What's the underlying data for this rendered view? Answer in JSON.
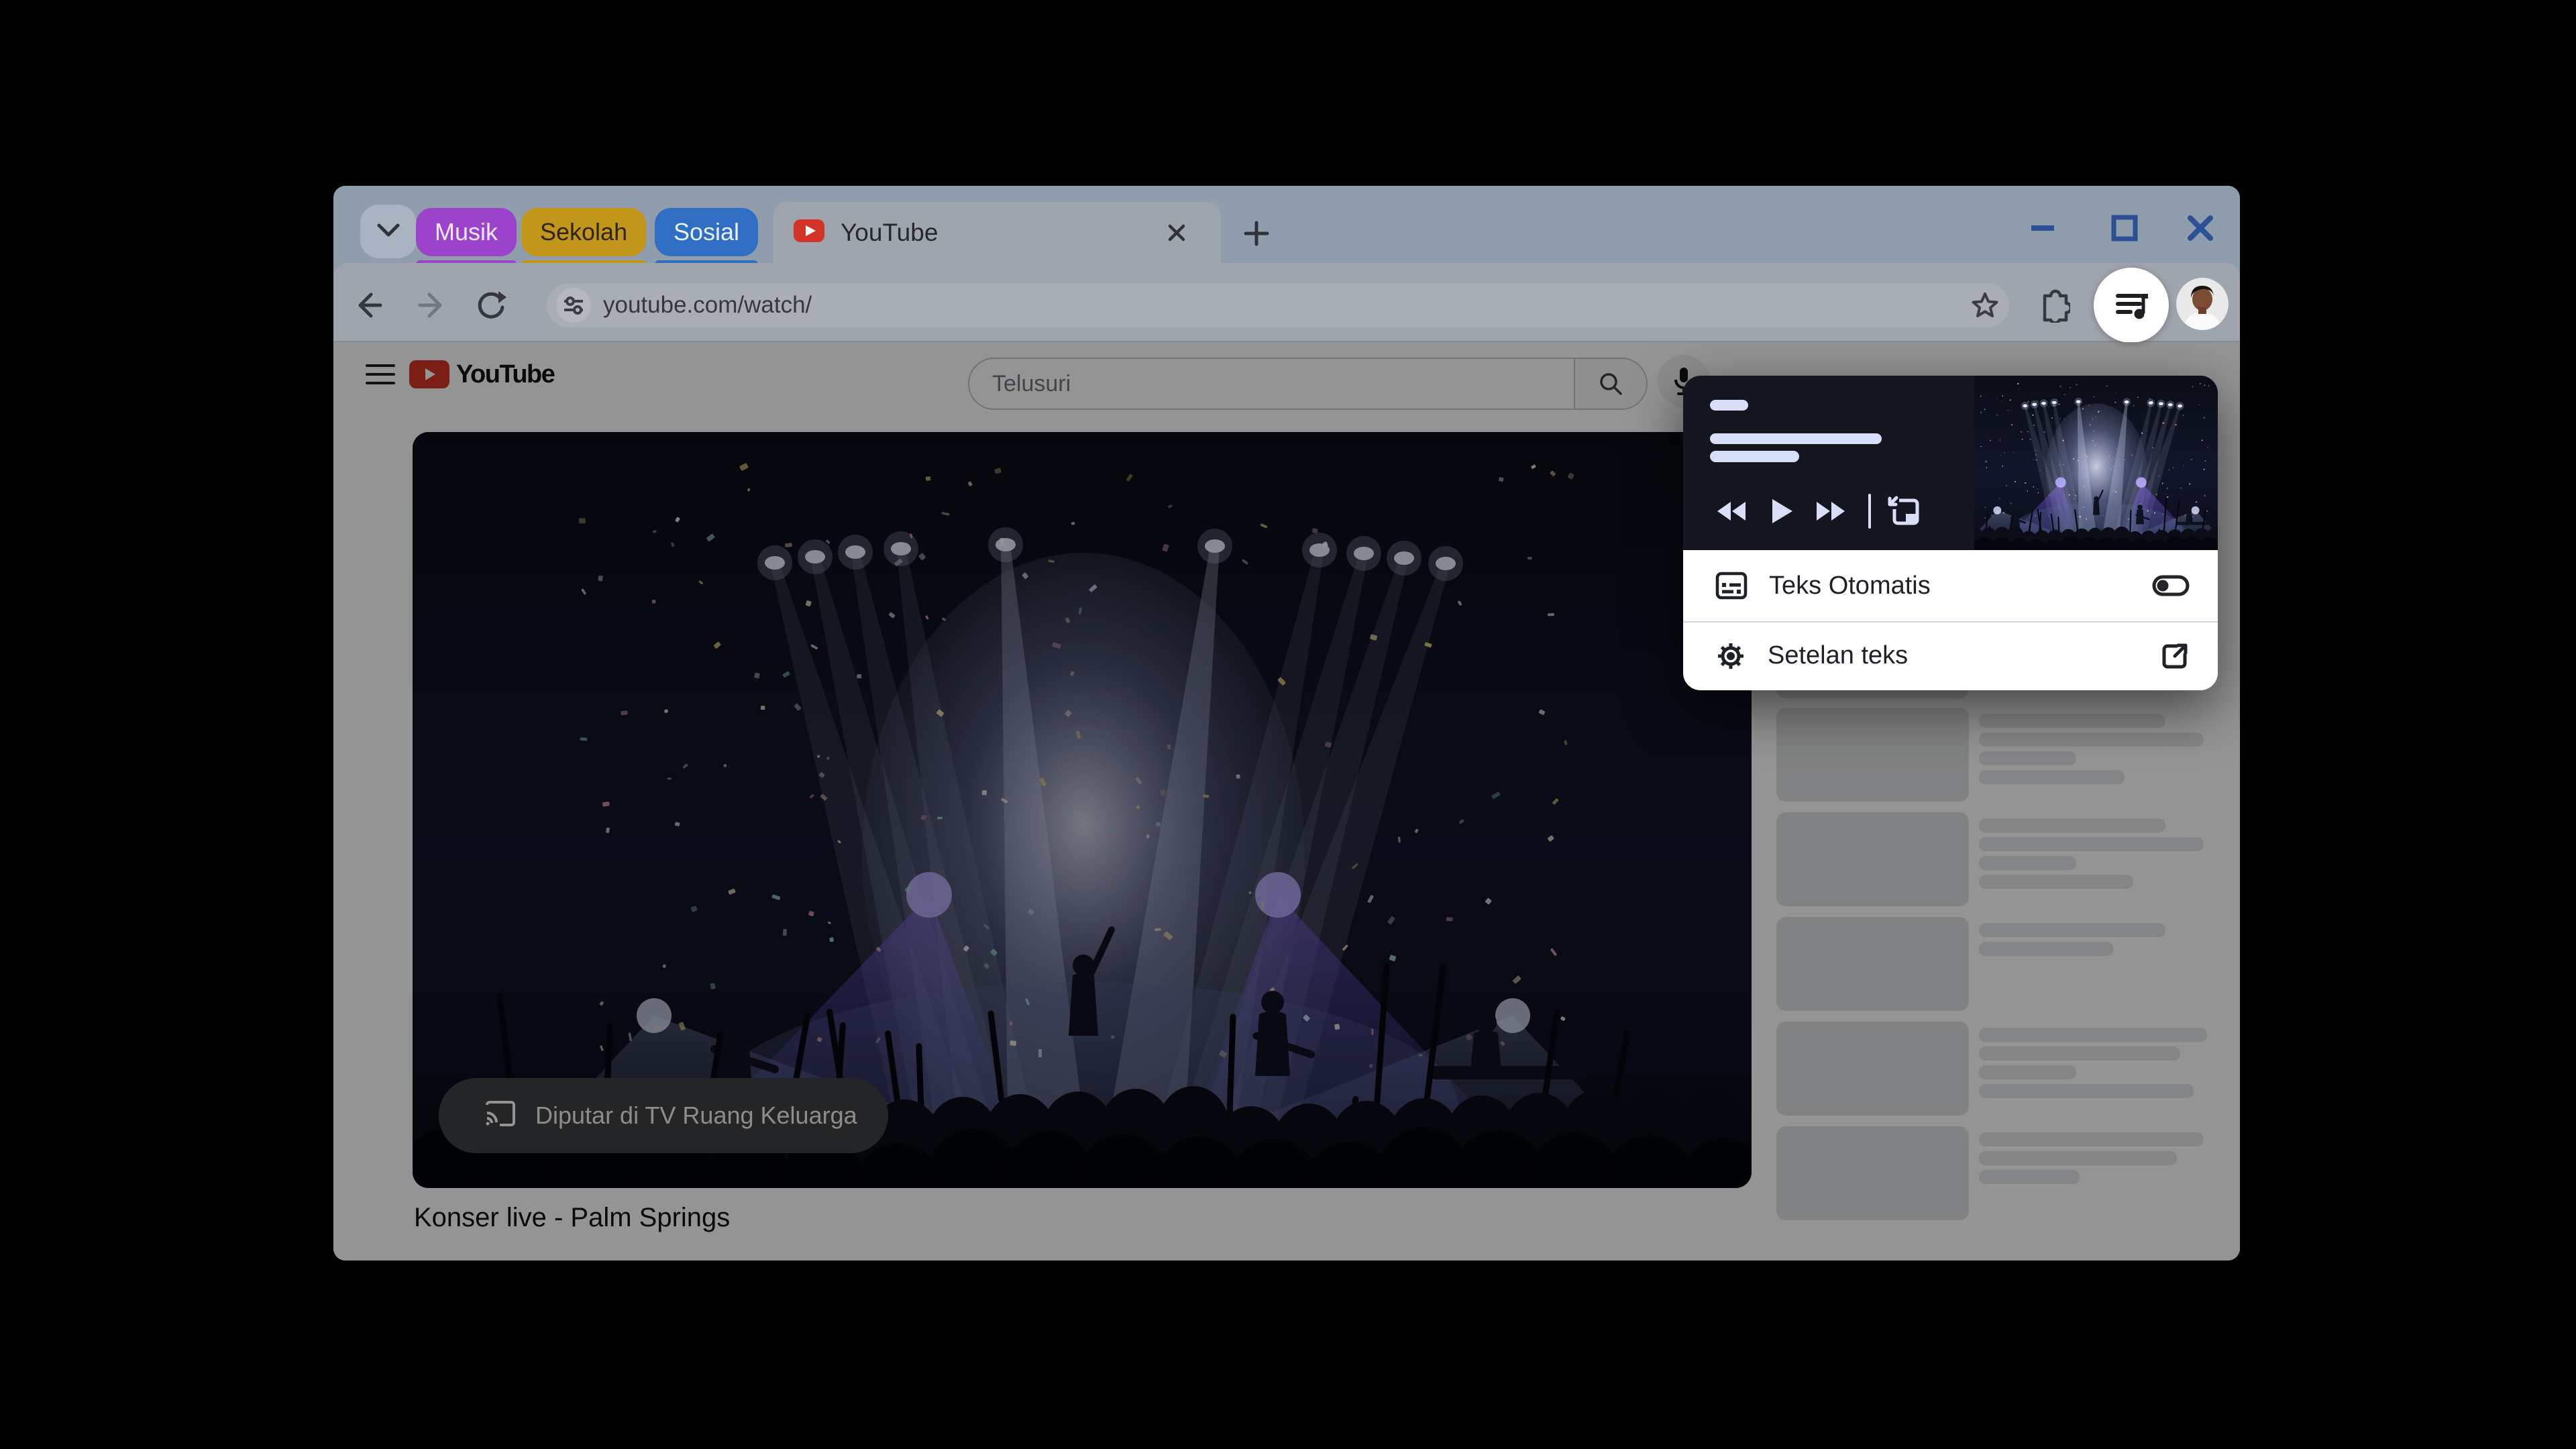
{
  "browser": {
    "tab_strip": {
      "groups": [
        {
          "label": "Musik",
          "bg": "#9b44cb",
          "fg": "#f2e8fa"
        },
        {
          "label": "Sekolah",
          "bg": "#c2961b",
          "fg": "#2d2517"
        },
        {
          "label": "Sosial",
          "bg": "#2f6ec2",
          "fg": "#e9f0fa"
        }
      ],
      "active_tab": {
        "label": "YouTube"
      }
    },
    "toolbar": {
      "url": "youtube.com/watch/"
    }
  },
  "page": {
    "logo_text": "YouTube",
    "search_placeholder": "Telusuri",
    "cast_label": "Diputar di TV Ruang Keluarga",
    "video_title": "Konser live - Palm Springs",
    "sidebar_skeleton": {
      "tops": [
        391,
        545,
        701,
        857,
        1013,
        1169
      ],
      "items": [
        {
          "lines": []
        },
        {
          "lines": [
            278,
            335,
            145,
            217
          ]
        },
        {
          "lines": [
            278,
            335,
            145,
            230
          ]
        },
        {
          "lines": [
            278,
            200
          ]
        },
        {
          "lines": [
            340,
            300,
            145,
            320
          ]
        },
        {
          "lines": [
            335,
            295,
            150
          ]
        }
      ]
    }
  },
  "popup": {
    "rows": [
      {
        "label": "Teks Otomatis",
        "control": "toggle",
        "toggle_on": false
      },
      {
        "label": "Setelan teks",
        "control": "open-in-new"
      }
    ]
  },
  "colors": {
    "tab_strip_bg": "#909dac",
    "toolbar_bg": "#9ea5ad",
    "omnibox_bg": "#a8aeb4",
    "window_controls": "#2b5096",
    "youtube_red": "#d33427",
    "popup_card_bg": "#14161f",
    "popup_skeleton_pill": "#d8def7",
    "menu_text": "#1e2126",
    "scrim": "rgba(0,0,0,0.42)"
  }
}
